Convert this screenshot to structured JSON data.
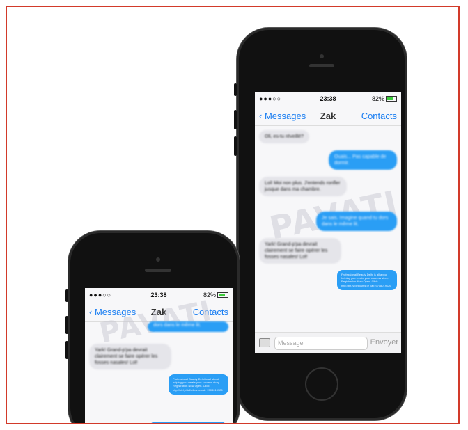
{
  "big_phone": {
    "status": {
      "signal": "●●●○○",
      "time": "23:38",
      "battery": "82%"
    },
    "nav": {
      "back": "Messages",
      "title": "Zak",
      "right": "Contacts"
    },
    "messages": [
      {
        "dir": "in",
        "text": "Oli, es-tu réveillé?"
      },
      {
        "dir": "out",
        "text": "Ouais... Pas capable de dormir."
      },
      {
        "dir": "in",
        "text": "Lol! Moi non plus. J'entends ronfler jusque dans ma chambre."
      },
      {
        "dir": "out",
        "text": "Je sais. Imagine quand tu dors dans le même lit."
      },
      {
        "dir": "in",
        "text": "Yark! Grand-p'pa devrait clairement se faire opérer les fosses nasales! Lol!"
      },
      {
        "dir": "out",
        "text": "Professional Beauty Delhi is all about helping you create your success story. Registration Now Open. Click: http://bit.ly/delhi4ms or call: 9708019126"
      }
    ],
    "composer": {
      "placeholder": "Message",
      "send": "Envoyer"
    }
  },
  "small_phone": {
    "status": {
      "signal": "●●●○○",
      "time": "23:38",
      "battery": "82%"
    },
    "nav": {
      "back": "Messages",
      "title": "Zak",
      "right": "Contacts"
    },
    "messages": [
      {
        "dir": "out",
        "text": "dors dans le même lit."
      },
      {
        "dir": "in",
        "text": "Yark! Grand-p'pa devrait clairement se faire opérer les fosses nasales! Lol!"
      },
      {
        "dir": "out",
        "text": "Professional Beauty Delhi is all about helping you create your success story. Registration Now Open. Click: http://bit.ly/delhi4ms or call: 9708019126"
      }
    ]
  },
  "watermark": "PAVATI",
  "colors": {
    "border": "#d23a2a",
    "accent": "#1a7ef2",
    "bubble_out": "#2a9ef5",
    "bubble_in": "#e5e5ea"
  }
}
